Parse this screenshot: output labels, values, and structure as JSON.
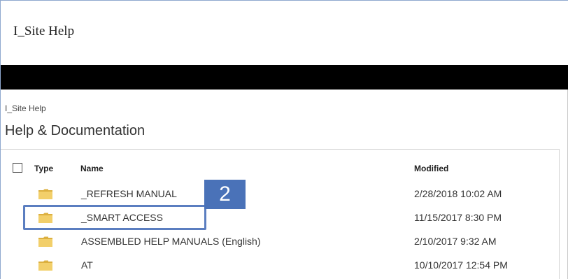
{
  "app": {
    "title": "I_Site Help"
  },
  "breadcrumb": "I_Site Help",
  "page_title": "Help & Documentation",
  "table": {
    "columns": {
      "type": "Type",
      "name": "Name",
      "modified": "Modified"
    },
    "rows": [
      {
        "name": "_REFRESH MANUAL",
        "modified": "2/28/2018 10:02 AM",
        "icon": "folder-icon"
      },
      {
        "name": "_SMART ACCESS",
        "modified": "11/15/2017 8:30 PM",
        "icon": "folder-icon"
      },
      {
        "name": "ASSEMBLED HELP MANUALS (English)",
        "modified": "2/10/2017 9:32 AM",
        "icon": "folder-icon"
      },
      {
        "name": "AT",
        "modified": "10/10/2017 12:54 PM",
        "icon": "folder-icon"
      }
    ]
  },
  "callout": {
    "label": "2",
    "color": "#4a72b8"
  },
  "colors": {
    "highlight_border": "#5b7ec0",
    "folder_fill": "#f2cf6a",
    "folder_shade": "#dcb040",
    "top_bar": "#000000"
  }
}
